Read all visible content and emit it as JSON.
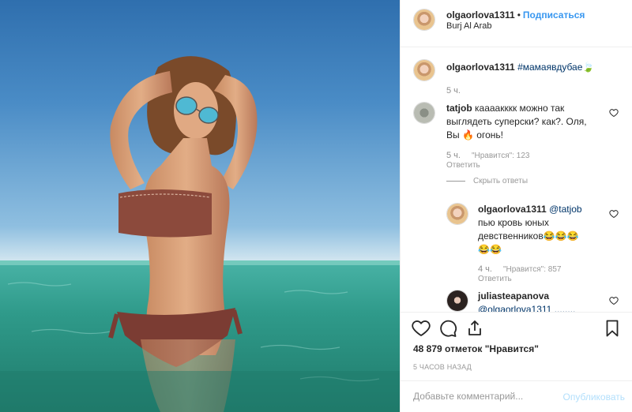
{
  "post": {
    "owner": "olgaorlova1311",
    "follow_separator": "•",
    "follow_label": "Подписаться",
    "location": "Burj Al Arab"
  },
  "caption": {
    "username": "olgaorlova1311",
    "hashtag": "#мамаявдубае",
    "emoji": "🍃",
    "time": "5 ч."
  },
  "comments": [
    {
      "username": "tatjob",
      "text_line1": "каааакккк можно так",
      "text_line2": "выглядеть суперски? как?. Оля,",
      "text_line3_prefix": "Вы",
      "text_line3_emoji": "🔥",
      "text_line3_suffix": "огонь!",
      "time": "5 ч.",
      "likes": "\"Нравится\": 123",
      "reply_label": "Ответить",
      "hide_replies_label": "Скрыть ответы"
    }
  ],
  "replies": [
    {
      "username": "olgaorlova1311",
      "mention": "@tatjob",
      "text_line2": "пью кровь юных",
      "text_line3": "девственников",
      "emojis_line3": "😂😂😂",
      "emojis_line4": "😂😂",
      "time": "4 ч.",
      "likes": "\"Нравится\": 857",
      "reply_label": "Ответить"
    },
    {
      "username": "juliasteapanova",
      "text_partial": "@olgaorlova1311 ........"
    }
  ],
  "stats": {
    "likes": "48 879 отметок \"Нравится\"",
    "posted_ago": "5 ЧАСОВ НАЗАД"
  },
  "comment_input": {
    "placeholder": "Добавьте комментарий...",
    "publish_label": "Опубликовать"
  },
  "icons": [
    "heart-icon",
    "comment-icon",
    "share-icon",
    "bookmark-icon"
  ],
  "colors": {
    "link": "#3897f0",
    "hashtag": "#003569",
    "muted": "#999999",
    "border": "#efefef"
  }
}
